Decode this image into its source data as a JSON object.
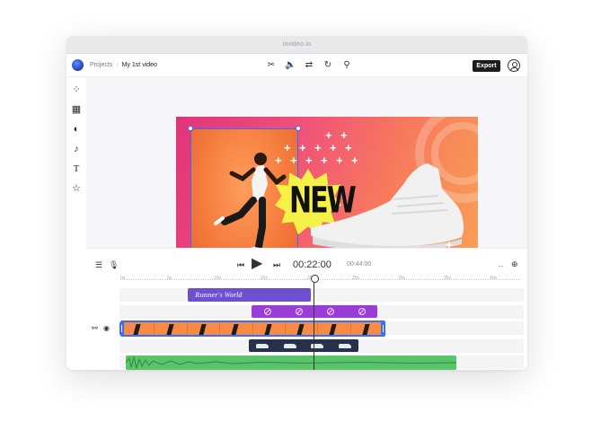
{
  "window": {
    "title": "invideo.io"
  },
  "header": {
    "breadcrumb_root": "Projects",
    "breadcrumb_sep": "›",
    "project_name": "My 1st video",
    "export_label": "Export",
    "tool_icons": [
      "scissors-icon",
      "volume-icon",
      "swap-icon",
      "rotate-icon",
      "magic-wand-icon"
    ]
  },
  "sidebar": {
    "items": [
      "elements-icon",
      "media-library-icon",
      "filters-icon",
      "music-icon",
      "text-icon",
      "favorites-icon"
    ]
  },
  "canvas": {
    "headline": "NEW",
    "accent": "#f6f146",
    "selection_color": "#3d6bff"
  },
  "timeline": {
    "current_time": "00:22:00",
    "total_time": "00:44:00",
    "ruler": [
      "0s",
      "5s",
      "10s",
      "15s",
      "20s",
      "25s",
      "30s",
      "35s",
      "40s"
    ],
    "text_clip_label": "Runner's World",
    "colors": {
      "text_clip": "#6f4fd1",
      "effects": "#9a3dd6",
      "video": "#f58b45",
      "overlay": "#26314a",
      "audio": "#5ac46b"
    }
  }
}
